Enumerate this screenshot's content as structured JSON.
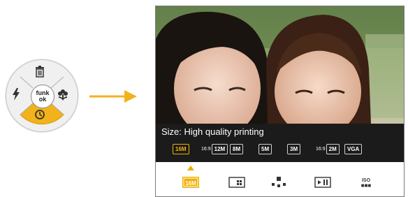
{
  "colors": {
    "accent": "#f0b000",
    "panel": "#1b1b1b",
    "arrow": "#f2b21c"
  },
  "control_pad": {
    "center_line1": "funk",
    "center_line2": "ok",
    "top_icon": "trash-icon",
    "left_icon": "flash-icon",
    "right_icon": "macro-flower-icon",
    "bottom_icon": "self-timer-icon",
    "bottom_highlighted": true
  },
  "size_menu": {
    "title": "Size: High quality printing",
    "options": [
      {
        "label": "16M",
        "sup": "",
        "selected": true
      },
      {
        "label": "12M",
        "sup": "16:9",
        "selected": false
      },
      {
        "label": "8M",
        "sup": "",
        "selected": false
      },
      {
        "label": "5M",
        "sup": "",
        "selected": false
      },
      {
        "label": "3M",
        "sup": "",
        "selected": false
      },
      {
        "label": "2M",
        "sup": "16:9",
        "selected": false
      },
      {
        "label": "VGA",
        "sup": "",
        "selected": false
      }
    ]
  },
  "menu_bar": {
    "icons": [
      "image-size-icon",
      "quality-grid-icon",
      "exposure-icon",
      "video-size-icon",
      "iso-icon"
    ],
    "selected_index": 0,
    "texts": [
      "16M",
      "",
      "",
      "",
      "ISO"
    ]
  }
}
